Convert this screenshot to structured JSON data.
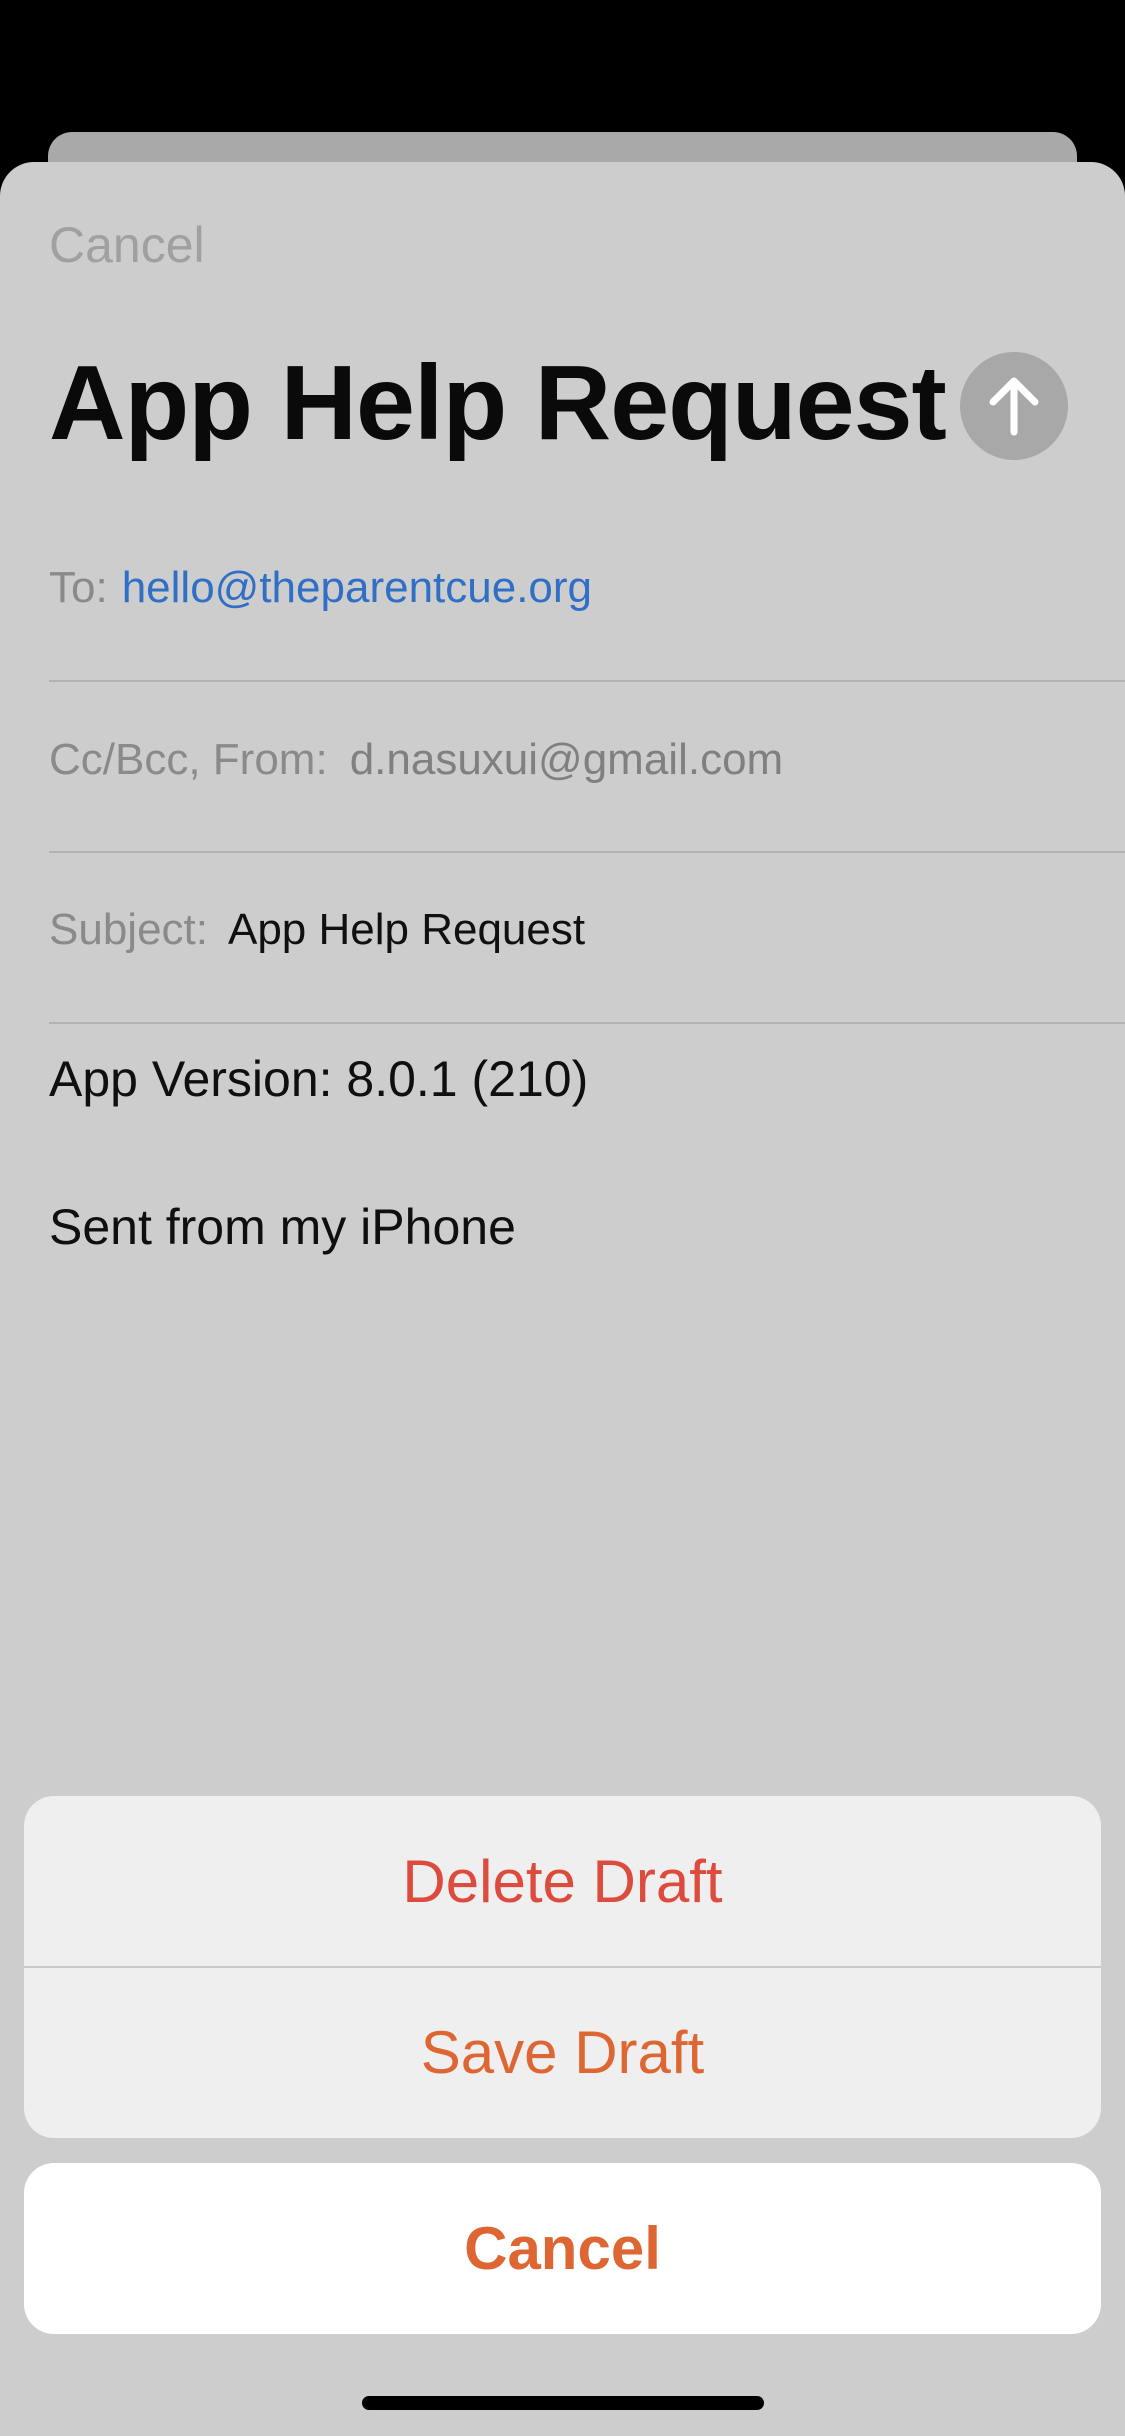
{
  "compose": {
    "cancel_label": "Cancel",
    "title": "App Help Request",
    "to_label": "To:",
    "to_value": "hello@theparentcue.org",
    "ccbcc_label": "Cc/Bcc, From:",
    "from_value": "d.nasuxui@gmail.com",
    "subject_label": "Subject:",
    "subject_value": "App Help Request",
    "body_lines": [
      "App Version: 8.0.1 (210)",
      "Sent from my iPhone"
    ],
    "send_icon": "arrow-up-icon"
  },
  "action_sheet": {
    "delete_label": "Delete Draft",
    "save_label": "Save Draft",
    "cancel_label": "Cancel"
  },
  "colors": {
    "destructive": "#dc4b3e",
    "accent": "#dd6633",
    "link": "#2f6fc6"
  }
}
